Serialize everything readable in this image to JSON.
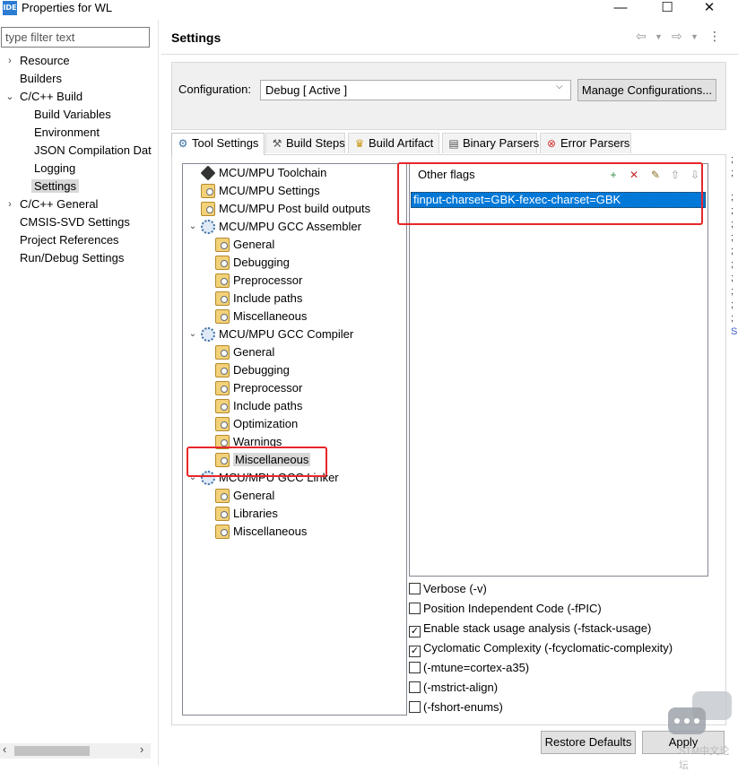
{
  "window": {
    "icon_text": "IDE",
    "title": "Properties for WL",
    "controls": {
      "minimize": "—",
      "maximize": "☐",
      "close": "✕"
    }
  },
  "nav": {
    "filter_placeholder": "type filter text",
    "items": [
      {
        "label": "Resource",
        "arrow": "›"
      },
      {
        "label": "Builders"
      },
      {
        "label": "C/C++ Build",
        "arrow": "⌄"
      },
      {
        "label": "Build Variables"
      },
      {
        "label": "Environment"
      },
      {
        "label": "JSON Compilation Dat"
      },
      {
        "label": "Logging"
      },
      {
        "label": "Settings",
        "selected": true
      },
      {
        "label": "C/C++ General",
        "arrow": "›"
      },
      {
        "label": "CMSIS-SVD Settings"
      },
      {
        "label": "Project References"
      },
      {
        "label": "Run/Debug Settings"
      }
    ],
    "scroll_left": "‹",
    "scroll_right": "›"
  },
  "header": {
    "title": "Settings",
    "back_icon": "⇦",
    "forward_icon": "⇨",
    "menu_icon": "⋮"
  },
  "config": {
    "label": "Configuration:",
    "value": "Debug  [ Active ]",
    "manage_label": "Manage Configurations..."
  },
  "tabs": [
    {
      "label": "Tool Settings",
      "icon": "gear-icon",
      "active": true
    },
    {
      "label": "Build Steps",
      "icon": "hammer-icon"
    },
    {
      "label": "Build Artifact",
      "icon": "trophy-icon"
    },
    {
      "label": "Binary Parsers",
      "icon": "binary-icon"
    },
    {
      "label": "Error Parsers",
      "icon": "error-icon"
    }
  ],
  "tree": [
    {
      "label": "MCU/MPU Toolchain",
      "icon": "chip",
      "level": 1
    },
    {
      "label": "MCU/MPU Settings",
      "icon": "folder",
      "level": 1
    },
    {
      "label": "MCU/MPU Post build outputs",
      "icon": "folder",
      "level": 1
    },
    {
      "label": "MCU/MPU GCC Assembler",
      "icon": "gear",
      "level": 1,
      "expanded": true
    },
    {
      "label": "General",
      "icon": "folder",
      "level": 2
    },
    {
      "label": "Debugging",
      "icon": "folder",
      "level": 2
    },
    {
      "label": "Preprocessor",
      "icon": "folder",
      "level": 2
    },
    {
      "label": "Include paths",
      "icon": "folder",
      "level": 2
    },
    {
      "label": "Miscellaneous",
      "icon": "folder",
      "level": 2
    },
    {
      "label": "MCU/MPU GCC Compiler",
      "icon": "gear",
      "level": 1,
      "expanded": true
    },
    {
      "label": "General",
      "icon": "folder",
      "level": 2
    },
    {
      "label": "Debugging",
      "icon": "folder",
      "level": 2
    },
    {
      "label": "Preprocessor",
      "icon": "folder",
      "level": 2
    },
    {
      "label": "Include paths",
      "icon": "folder",
      "level": 2
    },
    {
      "label": "Optimization",
      "icon": "folder",
      "level": 2
    },
    {
      "label": "Warnings",
      "icon": "folder",
      "level": 2
    },
    {
      "label": "Miscellaneous",
      "icon": "folder",
      "level": 2,
      "selected": true
    },
    {
      "label": "MCU/MPU GCC Linker",
      "icon": "gear",
      "level": 1,
      "expanded": true
    },
    {
      "label": "General",
      "icon": "folder",
      "level": 2
    },
    {
      "label": "Libraries",
      "icon": "folder",
      "level": 2
    },
    {
      "label": "Miscellaneous",
      "icon": "folder",
      "level": 2
    }
  ],
  "flags": {
    "header": "Other flags",
    "buttons": [
      {
        "name": "add-flag-icon",
        "glyph": "+",
        "color": "#2e8b3d"
      },
      {
        "name": "delete-flag-icon",
        "glyph": "✕",
        "color": "#c62828"
      },
      {
        "name": "edit-flag-icon",
        "glyph": "✎",
        "color": "#8a6d1e"
      },
      {
        "name": "move-up-icon",
        "glyph": "⇧",
        "color": "#9a9a9a"
      },
      {
        "name": "move-down-icon",
        "glyph": "⇩",
        "color": "#9a9a9a"
      }
    ],
    "values": [
      "finput-charset=GBK-fexec-charset=GBK"
    ]
  },
  "options": [
    {
      "label": "Verbose (-v)",
      "checked": false
    },
    {
      "label": "Position Independent Code (-fPIC)",
      "checked": false
    },
    {
      "label": "Enable stack usage analysis (-fstack-usage)",
      "checked": true
    },
    {
      "label": "Cyclomatic Complexity (-fcyclomatic-complexity)",
      "checked": true
    },
    {
      "label": "(-mtune=cortex-a35)",
      "checked": false
    },
    {
      "label": "(-mstrict-align)",
      "checked": false
    },
    {
      "label": "(-fshort-enums)",
      "checked": false
    }
  ],
  "footer": {
    "restore_label": "Restore Defaults",
    "apply_label": "Apply"
  },
  "watermark": "STM中文论坛",
  "colors": {
    "selection": "#0078d7",
    "highlight_box": "#e8262a",
    "selected_item": "#d9d9d9"
  }
}
